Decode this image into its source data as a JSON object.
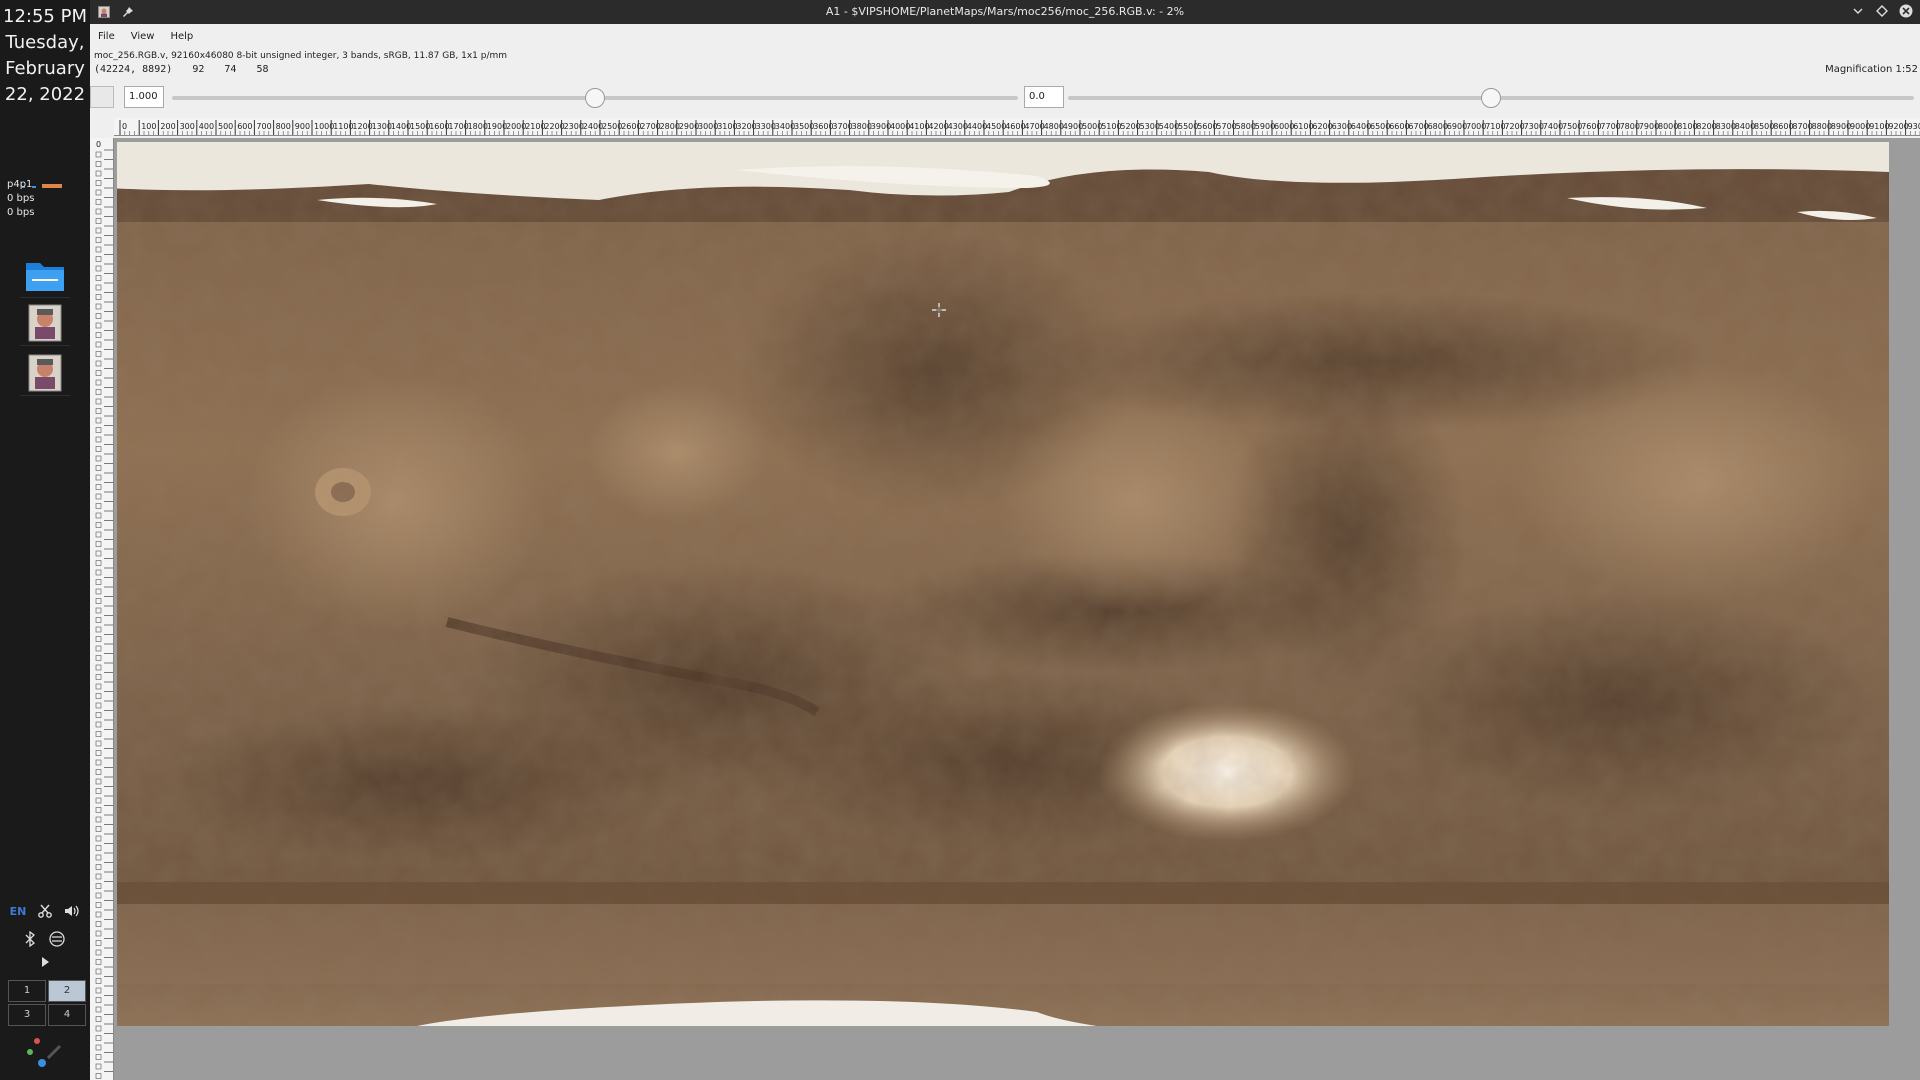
{
  "dock": {
    "clock": {
      "time": "12:55 PM",
      "weekday": "Tuesday,",
      "month_day": "February",
      "date_year": "22, 2022"
    },
    "network": {
      "iface": "p4p1",
      "rx": "0 bps",
      "tx": "0 bps"
    },
    "launchers": [
      {
        "name": "folder"
      },
      {
        "name": "vips"
      },
      {
        "name": "vips"
      }
    ],
    "tray": {
      "lang": "EN"
    },
    "pager": {
      "workspaces": [
        "1",
        "2",
        "3",
        "4"
      ],
      "active": "2"
    }
  },
  "window": {
    "title": "A1 - $VIPSHOME/PlanetMaps/Mars/moc256/moc_256.RGB.v: - 2%",
    "menu": [
      "File",
      "View",
      "Help"
    ],
    "info_line": "moc_256.RGB.v, 92160x46080 8-bit unsigned integer, 3 bands, sRGB, 11.87 GB, 1x1 p/mm",
    "status": {
      "coords": "(42224,  8892)",
      "r": "92",
      "g": "74",
      "b": "58"
    },
    "magnification": "Magnification 1:52",
    "scale": {
      "value": "1.000",
      "fraction": 0.5
    },
    "offset": {
      "value": "0.0",
      "fraction": 0.5
    },
    "ruler_h_labels": [
      "0",
      "100",
      "200",
      "300",
      "400",
      "500",
      "600",
      "700",
      "800",
      "900",
      "1000",
      "1100",
      "1200",
      "1300",
      "1400",
      "1500",
      "1600",
      "1700",
      "1800",
      "1900",
      "2000",
      "2100",
      "2200",
      "2300",
      "2400",
      "2500",
      "2600",
      "2700",
      "2800",
      "2900",
      "3000",
      "3100",
      "3200",
      "3300",
      "3400",
      "3500",
      "3600",
      "3700",
      "3800",
      "3900",
      "4000",
      "4100",
      "4200",
      "4300",
      "4400",
      "4500",
      "4600",
      "4700",
      "4800",
      "4900",
      "5000",
      "5100",
      "5200",
      "5300",
      "5400",
      "5500",
      "5600",
      "5700",
      "5800",
      "5900",
      "6000",
      "6100",
      "6200",
      "6300",
      "6400",
      "6500",
      "6600",
      "6700",
      "6800",
      "6900",
      "7000",
      "7100",
      "7200",
      "7300",
      "7400",
      "7500",
      "7600",
      "7700",
      "7800",
      "7900",
      "8000",
      "8100",
      "8200",
      "8300",
      "8400",
      "8500",
      "8600",
      "8700",
      "8800",
      "8900",
      "9000",
      "9100",
      "9200",
      "9300"
    ],
    "ruler_v_first": "0"
  },
  "colors": {
    "mars_base": "#8a6a4a",
    "mars_dark": "#5b4331",
    "polar": "#f0ede6",
    "background": "#9c9c9c"
  }
}
